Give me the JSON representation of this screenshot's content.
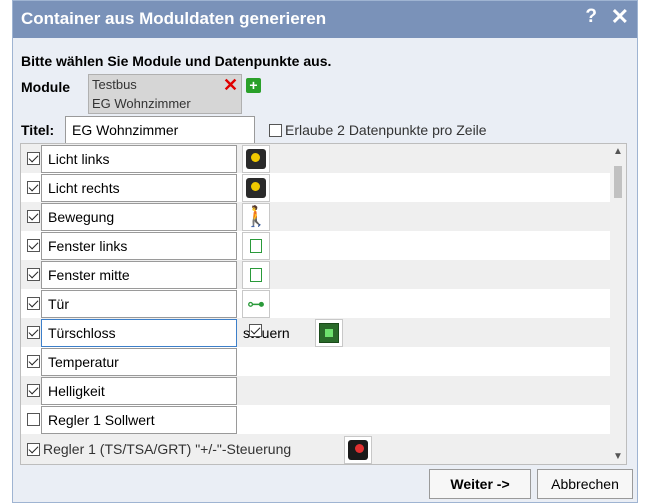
{
  "dialog": {
    "title": "Container aus Moduldaten generieren",
    "help_label": "?",
    "close_label": "✕"
  },
  "instruction": "Bitte wählen Sie Module und Datenpunkte aus.",
  "module": {
    "label": "Module",
    "items": [
      "Testbus",
      "EG Wohnzimmer"
    ],
    "remove_icon": "✕",
    "add_icon": "+"
  },
  "titel": {
    "label": "Titel:",
    "value": "EG Wohnzimmer"
  },
  "allow_two": {
    "label": "Erlaube 2 Datenpunkte pro Zeile",
    "checked": false
  },
  "rows": [
    {
      "label": "Licht links",
      "checked": true,
      "icon": "light-icon"
    },
    {
      "label": "Licht rechts",
      "checked": true,
      "icon": "light-icon"
    },
    {
      "label": "Bewegung",
      "checked": true,
      "icon": "motion-icon"
    },
    {
      "label": "Fenster links",
      "checked": true,
      "icon": "window-icon"
    },
    {
      "label": "Fenster mitte",
      "checked": true,
      "icon": "window-icon"
    },
    {
      "label": "Tür",
      "checked": true,
      "icon": "door-key-icon"
    },
    {
      "label": "Türschloss",
      "checked": true,
      "steuern_label": "steuern",
      "steuern_checked": true,
      "icon": "lock-icon"
    },
    {
      "label": "Temperatur",
      "checked": true
    },
    {
      "label": "Helligkeit",
      "checked": true
    },
    {
      "label": "Regler 1 Sollwert",
      "checked": false
    }
  ],
  "regler_row": {
    "label": "Regler 1 (TS/TSA/GRT) \"+/-\"-Steuerung",
    "checked": true,
    "icon": "regler-icon"
  },
  "buttons": {
    "next": "Weiter ->",
    "cancel": "Abbrechen"
  },
  "colors": {
    "titlebar": "#7a92b9",
    "accent_red": "#e00000",
    "accent_green": "#2aa02a"
  }
}
